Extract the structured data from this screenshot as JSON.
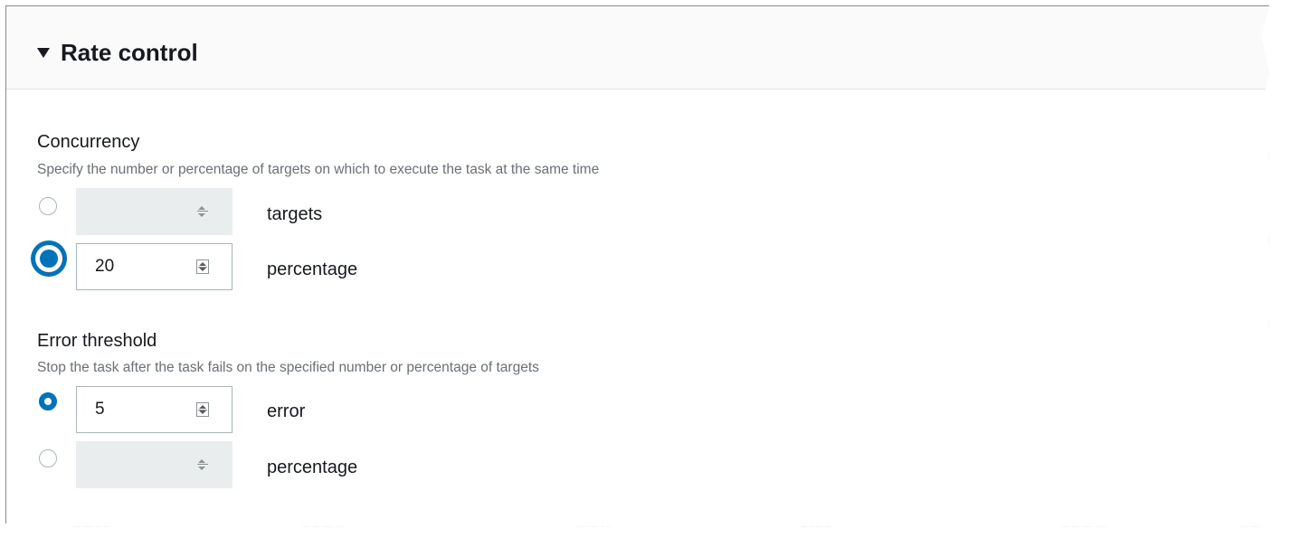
{
  "header": {
    "title": "Rate control"
  },
  "concurrency": {
    "title": "Concurrency",
    "description": "Specify the number or percentage of targets on which to execute the task at the same time",
    "options": [
      {
        "value": "",
        "unit": "targets",
        "selected": false,
        "disabled": true
      },
      {
        "value": "20",
        "unit": "percentage",
        "selected": true,
        "disabled": false
      }
    ]
  },
  "error_threshold": {
    "title": "Error threshold",
    "description": "Stop the task after the task fails on the specified number or percentage of targets",
    "options": [
      {
        "value": "5",
        "unit": "error",
        "selected": true,
        "disabled": false
      },
      {
        "value": "",
        "unit": "percentage",
        "selected": false,
        "disabled": true
      }
    ]
  },
  "colors": {
    "accent": "#0073bb",
    "disabled_field": "#eaeded",
    "muted_text": "#687078"
  },
  "icons": {
    "section_toggle": "caret-down-icon",
    "spinner": "number-spinner-icon"
  }
}
